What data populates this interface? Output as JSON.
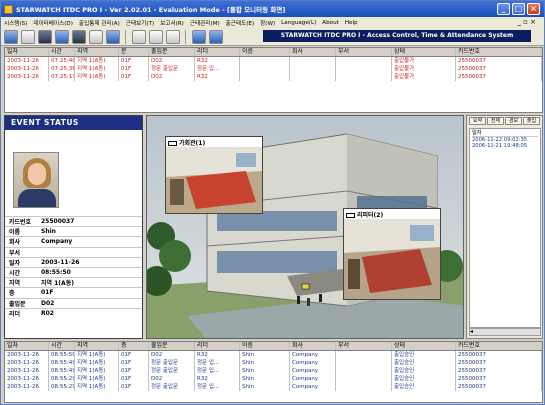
{
  "window": {
    "title": "STARWATCH ITDC PRO I - Ver 2.02.01 - Evaluation Mode - [통합 모니터링 화면]",
    "banner": "STARWATCH ITDC PRO I - Access Control, Time & Attendance System"
  },
  "menu": [
    "시스템(S)",
    "데이터베이스(D)",
    "출입통제 관리(A)",
    "근태보기(T)",
    "보고서(R)",
    "근태관리(M)",
    "출근태도(E)",
    "창(W)",
    "Language(L)",
    "About",
    "Help"
  ],
  "menu_right": "_ ▫ ×",
  "toolbar_icons": [
    "open-icon",
    "print-icon",
    "report-icon",
    "door-icon",
    "monitor-icon",
    "window-icon",
    "window2-icon",
    "camera-icon",
    "grid-icon",
    "dropdown-icon",
    "up-icon",
    "refresh-icon"
  ],
  "alarm_grid": {
    "headers": [
      "일자",
      "시간",
      "지역",
      "문",
      "출입문",
      "리더",
      "이름",
      "회사",
      "부서",
      "상태",
      "카드번호"
    ],
    "rows": [
      [
        "2003-11-26",
        "07:25:40",
        "지역 1(A동)",
        "01F",
        "D02",
        "R32",
        "",
        "",
        "",
        "출입불가",
        "25500037"
      ],
      [
        "2003-11-26",
        "07:25:36",
        "지역 1(A동)",
        "01F",
        "정문 출입문",
        "정문 입...",
        "",
        "",
        "",
        "출입불가",
        "25500037"
      ],
      [
        "2003-11-26",
        "07:25:13",
        "지역 1(A동)",
        "01F",
        "D02",
        "R32",
        "",
        "",
        "",
        "출입불가",
        "25500037"
      ]
    ]
  },
  "event_status": {
    "title": "EVENT STATUS",
    "fields": [
      {
        "k": "카드번호",
        "v": "25500037"
      },
      {
        "k": "이름",
        "v": "Shin"
      },
      {
        "k": "회사",
        "v": "Company"
      },
      {
        "k": "부서",
        "v": ""
      },
      {
        "k": "일자",
        "v": "2003-11-26"
      },
      {
        "k": "시간",
        "v": "08:55:50"
      },
      {
        "k": "지역",
        "v": "지역 1(A동)"
      },
      {
        "k": "층",
        "v": "01F"
      },
      {
        "k": "출입문",
        "v": "D02"
      },
      {
        "k": "리더",
        "v": "R02"
      }
    ]
  },
  "cameras": [
    {
      "label": "가회관(1)"
    },
    {
      "label": "리피터(2)"
    }
  ],
  "right_panel": {
    "tabs": [
      "요약",
      "전체",
      "경보",
      "출입"
    ],
    "header": "일자",
    "lines": [
      "2006-11-22 09:02:35",
      "2006-11-21 19:48:05"
    ]
  },
  "event_grid": {
    "headers": [
      "일자",
      "시간",
      "지역",
      "층",
      "출입문",
      "리더",
      "이름",
      "회사",
      "부서",
      "상태",
      "카드번호"
    ],
    "rows": [
      [
        "2003-11-26",
        "08:55:50",
        "지역 1(A동)",
        "01F",
        "D02",
        "R32",
        "Shin",
        "Company",
        "",
        "출입승인",
        "25500037"
      ],
      [
        "2003-11-26",
        "08:55:49",
        "지역 1(A동)",
        "01F",
        "정문 출입문",
        "정문 입...",
        "Shin",
        "Company",
        "",
        "출입승인",
        "25500037"
      ],
      [
        "2003-11-26",
        "08:55:49",
        "지역 1(A동)",
        "01F",
        "정문 출입문",
        "정문 입...",
        "Shin",
        "Company",
        "",
        "출입승인",
        "25500037"
      ],
      [
        "2003-11-26",
        "08:55:29",
        "지역 1(A동)",
        "01F",
        "D02",
        "R32",
        "Shin",
        "Company",
        "",
        "출입승인",
        "25500037"
      ],
      [
        "2003-11-26",
        "08:55:29",
        "지역 1(A동)",
        "01F",
        "정문 출입문",
        "정문 입...",
        "Shin",
        "Company",
        "",
        "출입승인",
        "25500037"
      ]
    ]
  },
  "colors": {
    "title": "#2a5dc8",
    "banner": "#0a1e5e",
    "event_title": "#1c2f82",
    "alarm_text": "#d01818",
    "event_text": "#1d3a8a"
  }
}
